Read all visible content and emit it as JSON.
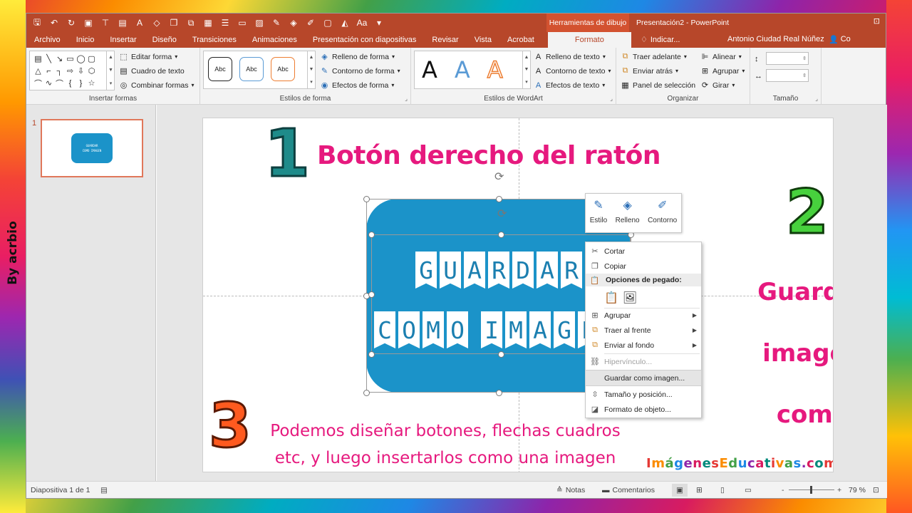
{
  "watermark": "By acrbio",
  "titlebar": {
    "context_group": "Herramientas de dibujo",
    "doc_title": "Presentación2 - PowerPoint"
  },
  "tabs": [
    "Archivo",
    "Inicio",
    "Insertar",
    "Diseño",
    "Transiciones",
    "Animaciones",
    "Presentación con diapositivas",
    "Revisar",
    "Vista",
    "Acrobat"
  ],
  "active_tab": "Formato",
  "tell_me": "Indicar...",
  "user_name": "Antonio Ciudad Real Núñez",
  "share_label": "Co",
  "ribbon": {
    "insert_shapes": {
      "label": "Insertar formas",
      "edit_shape": "Editar forma",
      "text_box": "Cuadro de texto",
      "merge_shapes": "Combinar formas"
    },
    "shape_styles": {
      "label": "Estilos de forma",
      "samples": [
        "Abc",
        "Abc",
        "Abc"
      ],
      "fill": "Relleno de forma",
      "outline": "Contorno de forma",
      "effects": "Efectos de forma"
    },
    "wordart": {
      "label": "Estilos de WordArt",
      "letters": [
        "A",
        "A",
        "A"
      ],
      "fill": "Relleno de texto",
      "outline": "Contorno de texto",
      "effects": "Efectos de texto"
    },
    "arrange": {
      "label": "Organizar",
      "bring_forward": "Traer adelante",
      "send_backward": "Enviar atrás",
      "selection_pane": "Panel de selección",
      "align": "Alinear",
      "group": "Agrupar",
      "rotate": "Girar"
    },
    "size": {
      "label": "Tamaño"
    }
  },
  "thumbnail": {
    "number": "1"
  },
  "slide": {
    "step1": "1",
    "heading": "Botón derecho del ratón",
    "step2": "2",
    "side_words": [
      "Guardar",
      "imagen",
      "como"
    ],
    "step3": "3",
    "bottom_text_1": "Podemos diseñar botones, flechas cuadros",
    "bottom_text_2": "etc, y luego insertarlos como una imagen",
    "site_logo": "ImágenesEducativas.com",
    "button_line1": "GUARDAR",
    "button_line2": "COMO IMAGEN"
  },
  "mini_toolbar": [
    "Estilo",
    "Relleno",
    "Contorno"
  ],
  "context_menu": {
    "cut": "Cortar",
    "copy": "Copiar",
    "paste_options": "Opciones de pegado:",
    "group": "Agrupar",
    "bring_to_front": "Traer al frente",
    "send_to_back": "Enviar al fondo",
    "hyperlink": "Hipervínculo...",
    "save_as_picture": "Guardar como imagen...",
    "size_position": "Tamaño y posición...",
    "format_object": "Formato de objeto..."
  },
  "statusbar": {
    "slide_info": "Diapositiva 1 de 1",
    "notes": "Notas",
    "comments": "Comentarios",
    "zoom": "79 %",
    "minus": "-",
    "plus": "+"
  },
  "colors": {
    "accent": "#b7472a",
    "heading_pink": "#e6197e",
    "button_blue": "#1b93c9"
  }
}
